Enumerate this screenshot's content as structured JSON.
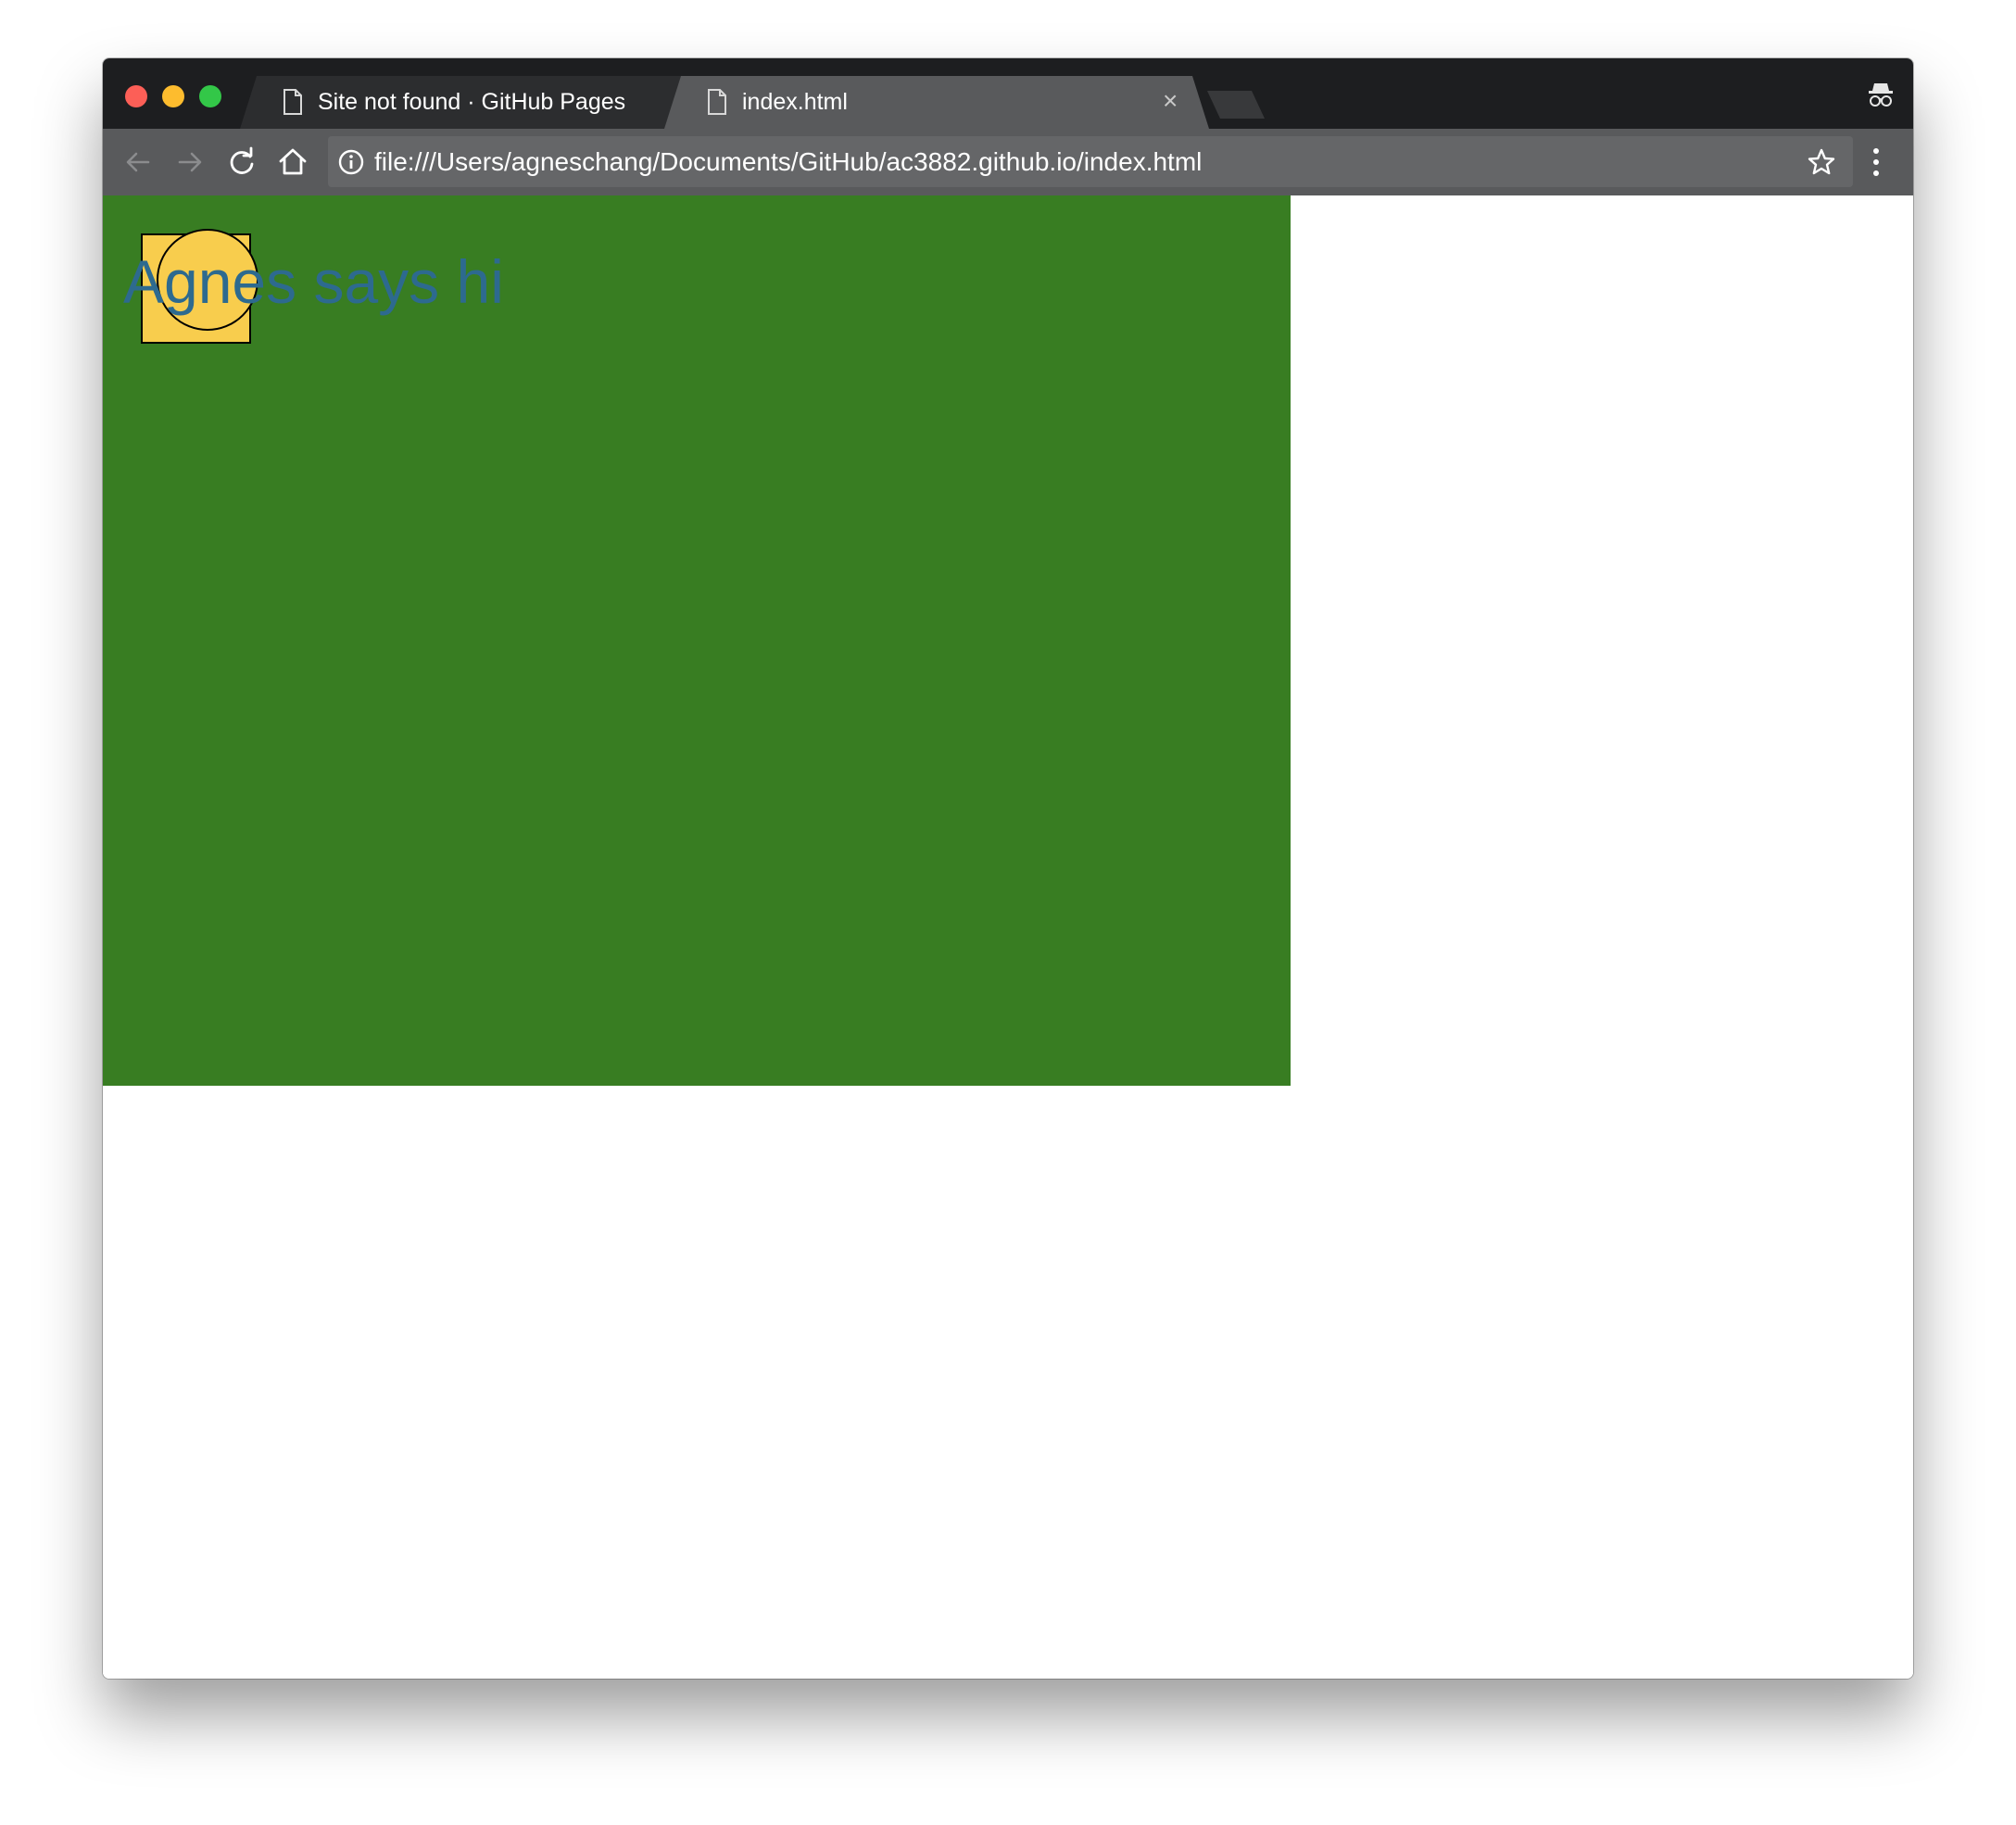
{
  "browser": {
    "tabs": [
      {
        "title": "Site not found · GitHub Pages",
        "active": false
      },
      {
        "title": "index.html",
        "active": true
      }
    ],
    "close_glyph": "×",
    "address_bar": {
      "url": "file:///Users/agneschang/Documents/GitHub/ac3882.github.io/index.html"
    },
    "icons": {
      "tab": "page-icon",
      "back": "arrow-left-icon",
      "forward": "arrow-right-icon",
      "reload": "reload-icon",
      "home": "home-icon",
      "info": "info-icon",
      "bookmark": "star-icon",
      "menu": "menu-dots-icon",
      "incognito": "incognito-icon"
    }
  },
  "page": {
    "heading": "Agnes says hi",
    "colors": {
      "canvas": "#387d22",
      "shape_fill": "#f8cd4d",
      "heading_text": "#2d6a8f"
    }
  }
}
